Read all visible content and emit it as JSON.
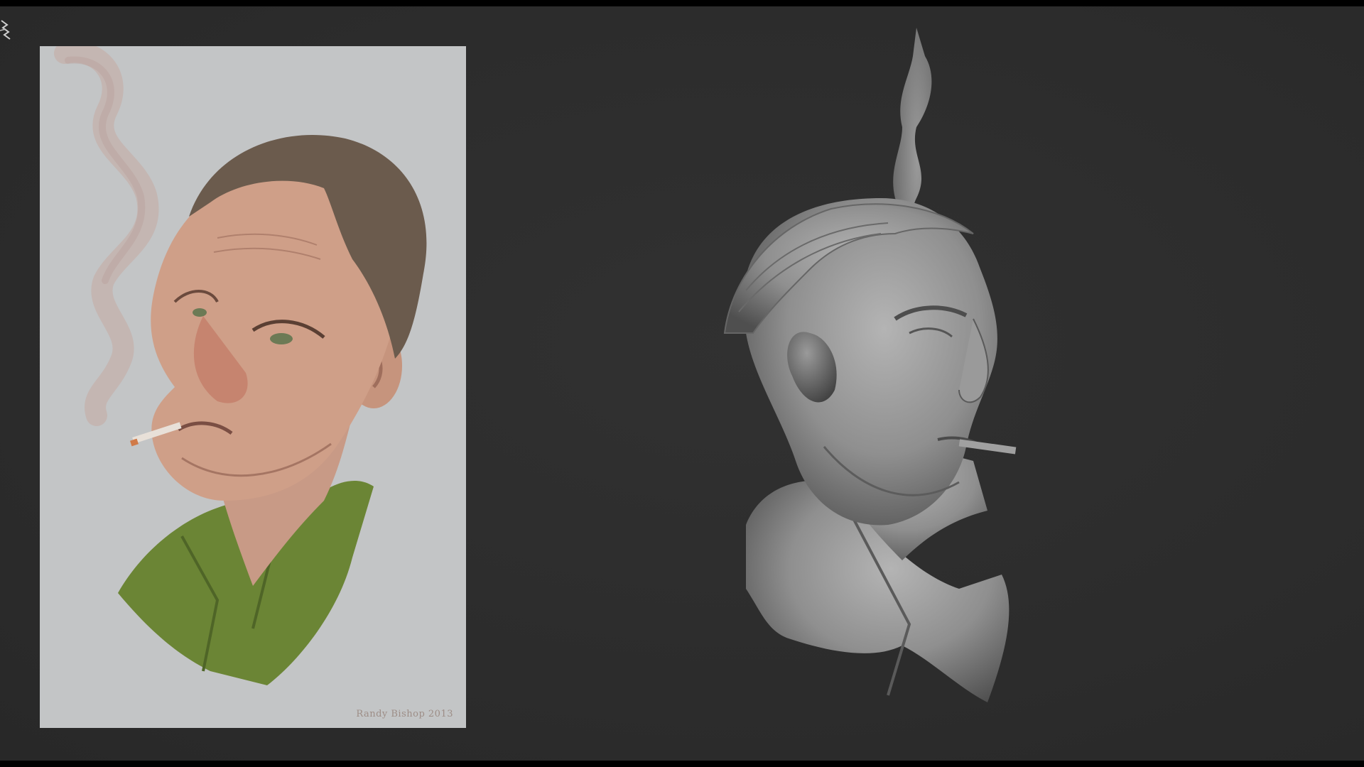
{
  "window": {
    "background_color": "#2e2e2e",
    "letterbox_color": "#000000"
  },
  "reference_image": {
    "signature": "Randy Bishop 2013",
    "signature_color": "#9d8d86",
    "background_color": "#c3c5c6",
    "shirt_color": "#6b8535",
    "skin_color": "#c99d86",
    "hair_color": "#6b5b4d"
  },
  "sculpt": {
    "material_color": "#8f8f8f"
  },
  "icons": {
    "corner": "zbrush-logo-icon"
  }
}
